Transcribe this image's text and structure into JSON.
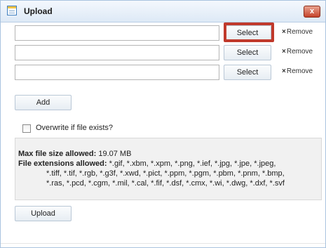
{
  "dialog": {
    "title": "Upload",
    "icon": "document-icon",
    "close_label": "x",
    "accent_close": "#c5432a"
  },
  "file_rows": [
    {
      "select_label": "Select",
      "remove_x": "×",
      "remove_label": "Remove",
      "highlighted": true
    },
    {
      "select_label": "Select",
      "remove_x": "×",
      "remove_label": "Remove",
      "highlighted": false
    },
    {
      "select_label": "Select",
      "remove_x": "×",
      "remove_label": "Remove",
      "highlighted": false
    }
  ],
  "highlight_color": "#c0392b",
  "add_label": "Add",
  "overwrite": {
    "label": "Overwrite if file exists?",
    "checked": false
  },
  "info": {
    "max_size_label": "Max file size allowed:",
    "max_size_value": "19.07 MB",
    "extensions_label": "File extensions allowed:",
    "extensions_value_1": "*.gif, *.xbm, *.xpm, *.png, *.ief, *.jpg, *.jpe, *.jpeg,",
    "extensions_value_2": "*.tiff, *.tif, *.rgb, *.g3f, *.xwd, *.pict, *.ppm, *.pgm, *.pbm, *.pnm, *.bmp,",
    "extensions_value_3": "*.ras, *.pcd, *.cgm, *.mil, *.cal, *.fif, *.dsf, *.cmx, *.wi, *.dwg, *.dxf, *.svf"
  },
  "upload_label": "Upload"
}
